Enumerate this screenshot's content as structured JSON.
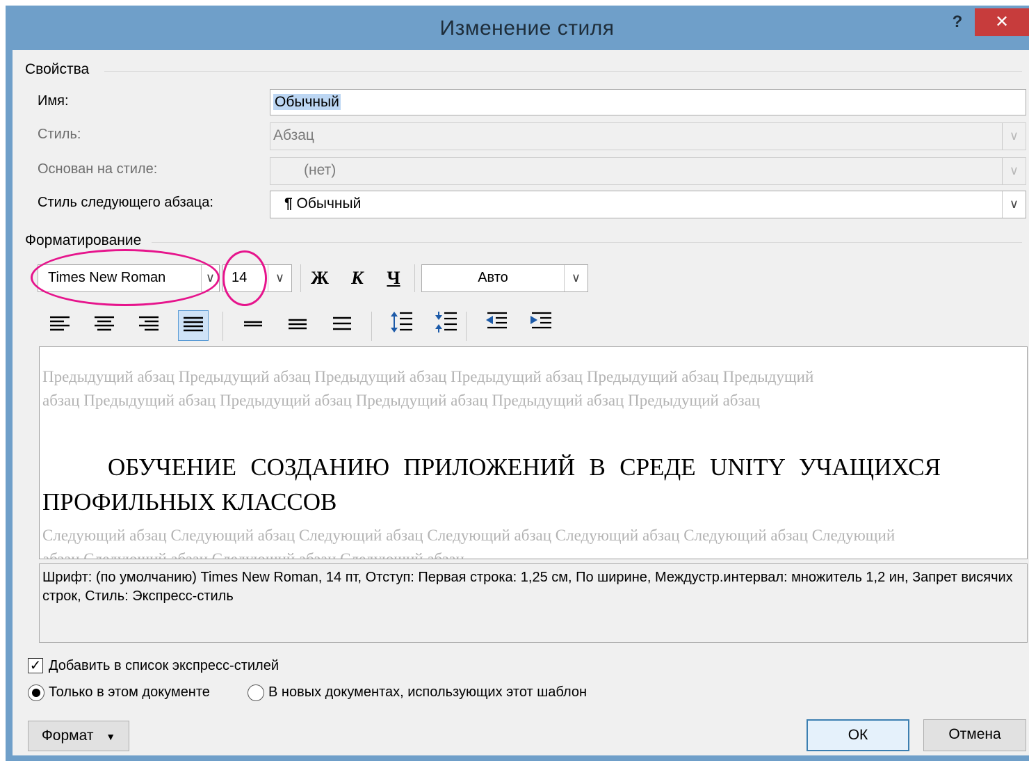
{
  "dialog": {
    "title": "Изменение стиля",
    "help_label": "?",
    "close_label": "✕"
  },
  "properties": {
    "group_label": "Свойства",
    "name_label": "Имя:",
    "name_value": "Обычный",
    "style_label": "Стиль:",
    "style_value": "Абзац",
    "based_on_label": "Основан на стиле:",
    "based_on_value": "(нет)",
    "next_style_label": "Стиль следующего абзаца:",
    "next_style_value": "Обычный",
    "next_style_icon": "¶"
  },
  "formatting": {
    "group_label": "Форматирование",
    "font_name": "Times New Roman",
    "font_size": "14",
    "bold_label": "Ж",
    "italic_label": "К",
    "underline_label": "Ч",
    "color_value": "Авто",
    "alignment_selected": "justify"
  },
  "preview": {
    "previous_text": "Предыдущий абзац Предыдущий абзац Предыдущий абзац Предыдущий абзац Предыдущий абзац Предыдущий абзац Предыдущий абзац Предыдущий абзац Предыдущий абзац Предыдущий абзац Предыдущий абзац",
    "main_text": "ОБУЧЕНИЕ СОЗДАНИЮ ПРИЛОЖЕНИЙ В СРЕДЕ UNITY УЧАЩИХСЯ ПРОФИЛЬНЫХ КЛАССОВ",
    "next_text": "Следующий абзац Следующий абзац Следующий абзац Следующий абзац Следующий абзац Следующий абзац Следующий абзац Следующий абзац Следующий абзац Следующий абзац"
  },
  "description": "Шрифт: (по умолчанию) Times New Roman, 14 пт, Отступ: Первая строка:  1,25 см, По ширине, Междустр.интервал:  множитель 1,2 ин, Запрет висячих строк, Стиль: Экспресс-стиль",
  "options": {
    "add_to_quick_styles_label": "Добавить в список экспресс-стилей",
    "add_to_quick_styles_checked": true,
    "only_this_doc_label": "Только в этом документе",
    "new_docs_label": "В новых документах, использующих этот шаблон",
    "selected_scope": "only_this_doc"
  },
  "buttons": {
    "format_label": "Формат",
    "ok_label": "ОК",
    "cancel_label": "Отмена"
  },
  "colors": {
    "title_bar": "#6f9fc9",
    "close_button": "#c73c3c",
    "annotation": "#e6148c"
  }
}
